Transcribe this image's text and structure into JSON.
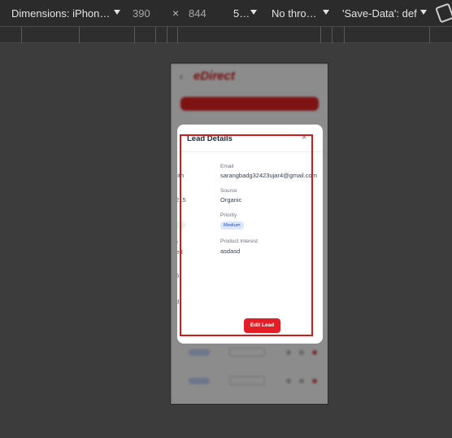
{
  "devtools": {
    "device": "Dimensions: iPhon…",
    "width": "390",
    "times": "×",
    "height": "844",
    "zoom": "5…",
    "throttling": "No thro…",
    "save_data": "'Save-Data': def"
  },
  "background_page": {
    "back_arrow": "‹",
    "logo_text": "eDirect"
  },
  "modal": {
    "title": "Lead Details",
    "close": "×",
    "email_label": "Email",
    "email_value": "sarangbadg32423ujar4@gmail.com",
    "source_label": "Source",
    "source_value": "Organic",
    "priority_label": "Priority",
    "priority_value": "Medium",
    "interest_label": "Product Interest",
    "interest_value": "asdasd",
    "edit_button": "Edit Lead",
    "left_col": {
      "v1": "mith",
      "v2": "4215",
      "v3": "To",
      "v4": "gned",
      "v5": "25",
      "v6": "d"
    }
  },
  "colors": {
    "accent_red": "#e41e26",
    "highlight_red": "#d11a1a",
    "badge_bg": "#dbe7ff"
  }
}
